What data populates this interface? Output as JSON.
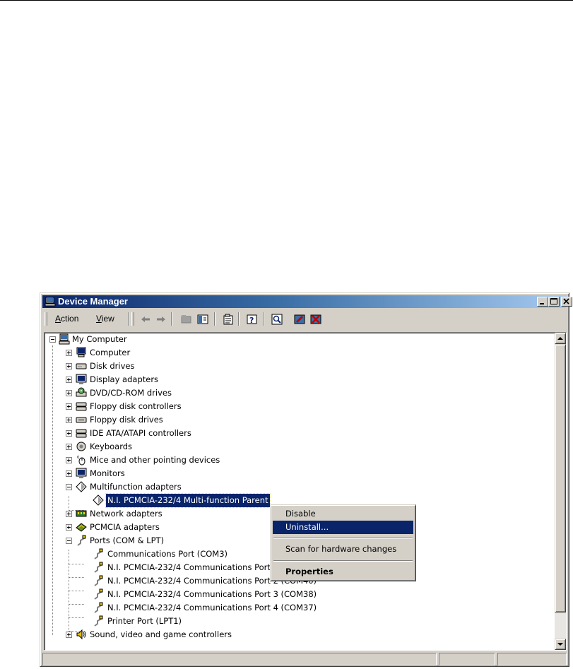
{
  "window": {
    "title": "Device Manager",
    "title_icon": "computer-manage-icon",
    "controls": [
      "minimize-icon",
      "maximize-icon",
      "close-icon"
    ]
  },
  "menu": {
    "action": {
      "accel": "A",
      "rest": "ction"
    },
    "view": {
      "accel": "V",
      "rest": "iew"
    }
  },
  "toolbar_icons": [
    "back-arrow-icon",
    "forward-arrow-icon",
    "up-folder-icon",
    "show-hide-tree-icon",
    "properties-icon",
    "help-icon",
    "scan-hardware-icon",
    "disable-device-icon",
    "uninstall-device-icon"
  ],
  "tree": {
    "root": "My Computer",
    "categories": {
      "computer": "Computer",
      "disk_drives": "Disk drives",
      "display_adapters": "Display adapters",
      "dvd_cdrom": "DVD/CD-ROM drives",
      "floppy_controllers": "Floppy disk controllers",
      "floppy_drives": "Floppy disk drives",
      "ide": "IDE ATA/ATAPI controllers",
      "keyboards": "Keyboards",
      "mice": "Mice and other pointing devices",
      "monitors": "Monitors",
      "multifunction": "Multifunction adapters",
      "network": "Network adapters",
      "pcmcia": "PCMCIA adapters",
      "ports": "Ports (COM & LPT)",
      "sound": "Sound, video and game controllers"
    },
    "multifunction_children": {
      "parent": "N.I. PCMCIA-232/4 Multi-function Parent"
    },
    "ports_children": {
      "com3": "Communications Port (COM3)",
      "port1": "N.I. PCMCIA-232/4 Communications Port 1 (COM39)",
      "port2": "N.I. PCMCIA-232/4 Communications Port 2 (COM40)",
      "port3": "N.I. PCMCIA-232/4 Communications Port 3 (COM38)",
      "port4": "N.I. PCMCIA-232/4 Communications Port 4 (COM37)",
      "lpt1": "Printer Port (LPT1)"
    }
  },
  "context_menu": {
    "disable": "Disable",
    "uninstall": "Uninstall...",
    "scan": "Scan for hardware changes",
    "properties": "Properties"
  },
  "colors": {
    "titlebar_start": "#0a246a",
    "titlebar_end": "#a6caf0",
    "selection": "#0a246a",
    "face": "#d4d0c8"
  }
}
